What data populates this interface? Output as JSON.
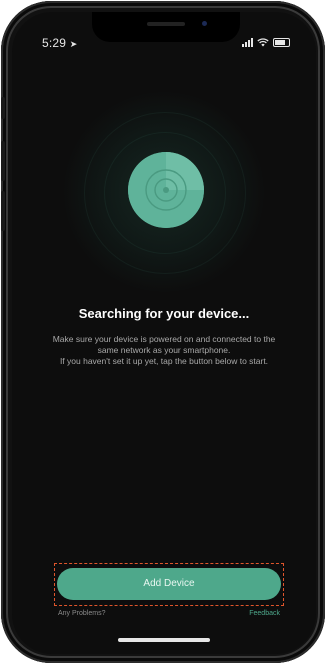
{
  "status_bar": {
    "time": "5:29",
    "location_icon": "location-arrow-icon",
    "signal_icon": "cellular-signal-icon",
    "wifi_icon": "wifi-icon",
    "battery_icon": "battery-icon"
  },
  "search": {
    "title": "Searching for your device...",
    "description_line1": "Make sure your device is powered on and connected to the same network as your smartphone.",
    "description_line2": "If you haven't set it up yet, tap the button below to start."
  },
  "actions": {
    "add_device_label": "Add Device",
    "any_problems_label": "Any Problems?",
    "feedback_label": "Feedback"
  },
  "colors": {
    "accent": "#4ea88b",
    "background": "#0d0d0d",
    "highlight_border": "#e0552b"
  }
}
